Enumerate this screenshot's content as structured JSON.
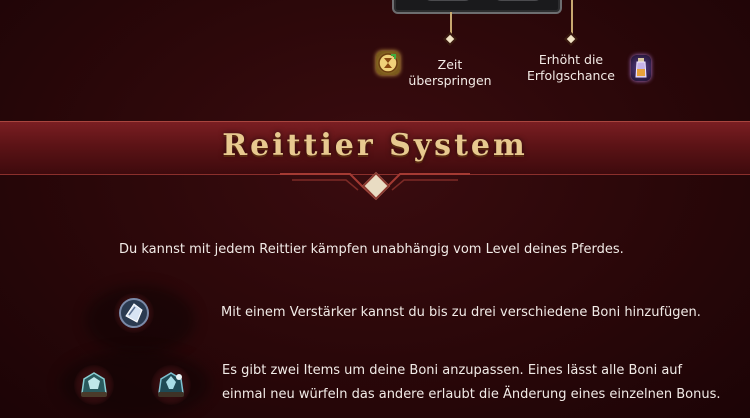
{
  "hints": {
    "skip_time": "Zeit\nüberspringen",
    "increase_chance": "Erhöht die\nErfolgschance"
  },
  "banner": {
    "title": "Reittier System"
  },
  "main": {
    "intro": "Du kannst mit jedem Reittier kämpfen unabhängig vom Level deines Pferdes.",
    "amplifier": "Mit einem Verstärker kannst du bis zu drei verschiedene Boni hinzufügen.",
    "items_line1": "Es gibt zwei Items um deine Boni anzupassen. Eines lässt alle Boni auf",
    "items_line2": "einmal neu würfeln das andere erlaubt die Änderung eines einzelnen Bonus."
  },
  "icons": {
    "skip_time_icon": "hourglass-scroll-icon",
    "chance_icon": "potion-icon",
    "amplifier_icon": "amplifier-gem-icon",
    "reroll_all_icon": "reroll-stone-icon",
    "change_one_icon": "change-stone-icon"
  },
  "colors": {
    "background": "#2a0709",
    "banner": "#5c1316",
    "title_gold": "#e7c98f",
    "text": "#f2ebe7"
  }
}
